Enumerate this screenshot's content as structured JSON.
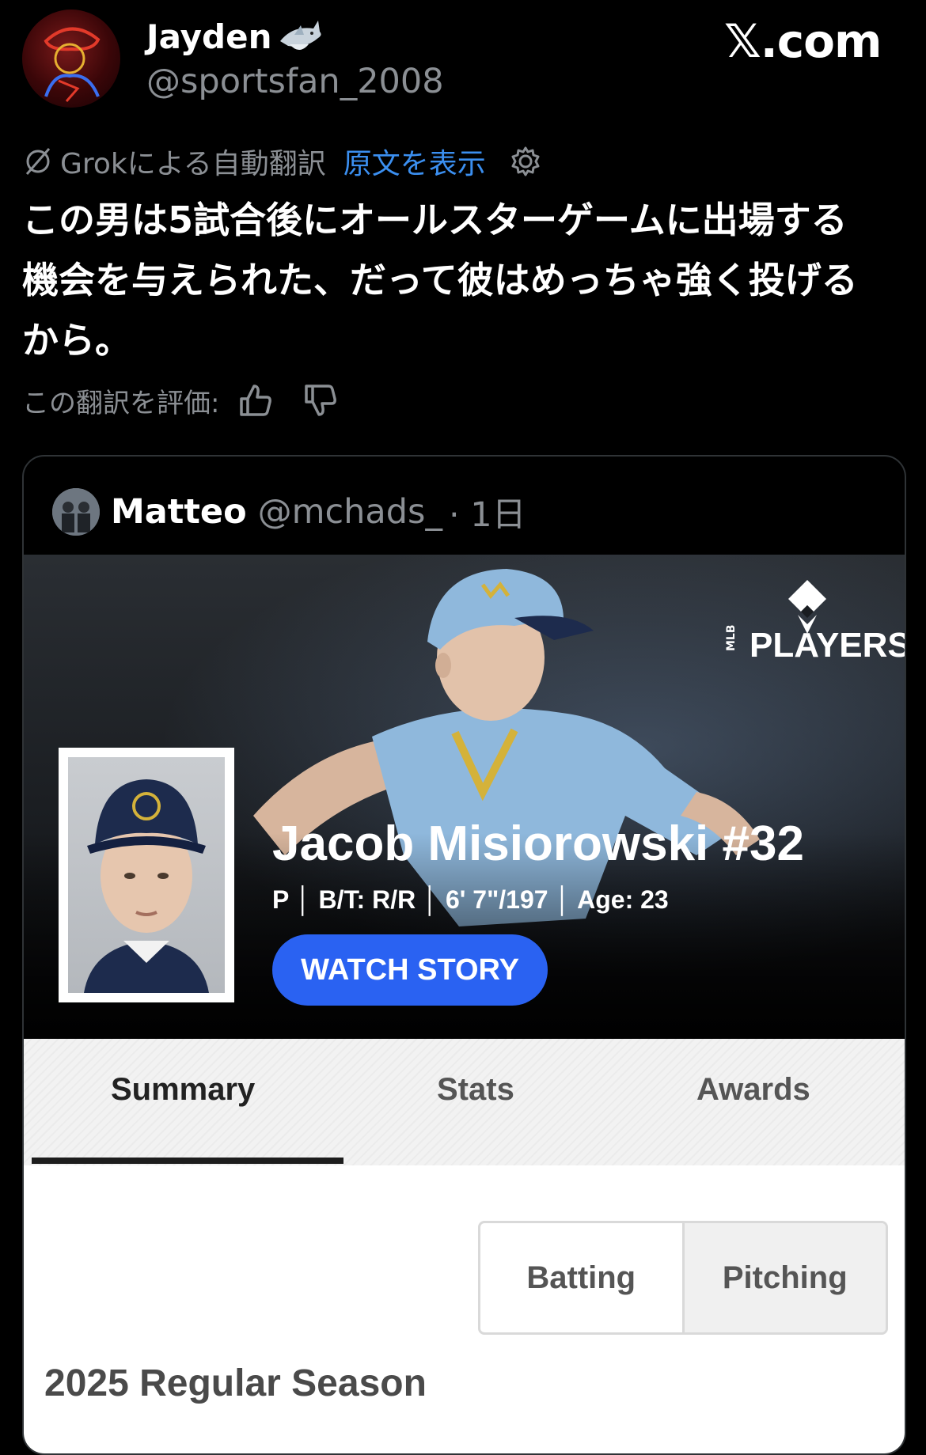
{
  "header": {
    "display_name": "Jayden",
    "handle": "@sportsfan_2008",
    "watermark": "𝕏.com"
  },
  "translation": {
    "label": "Grokによる自動翻訳",
    "show_original": "原文を表示",
    "text": "この男は5試合後にオールスターゲームに出場する\n機会を与えられた、だって彼はめっちゃ強く投げる\nから。",
    "rate_label": "この翻訳を評価:"
  },
  "quote": {
    "name": "Matteo",
    "handle": "@mchads_",
    "time": "· 1日"
  },
  "card": {
    "brand": "PLAYERS",
    "brand_small": "MLB",
    "player_name": "Jacob Misiorowski #32",
    "player_info": "P │ B/T: R/R │ 6' 7\"/197 │ Age: 23",
    "watch_button": "WATCH STORY",
    "tabs": [
      "Summary",
      "Stats",
      "Awards"
    ],
    "toggle": [
      "Batting",
      "Pitching"
    ],
    "season": "2025 Regular Season"
  },
  "colors": {
    "accent_blue": "#3b8ff0",
    "button_blue": "#2a62f2",
    "muted": "#8b8f94"
  }
}
